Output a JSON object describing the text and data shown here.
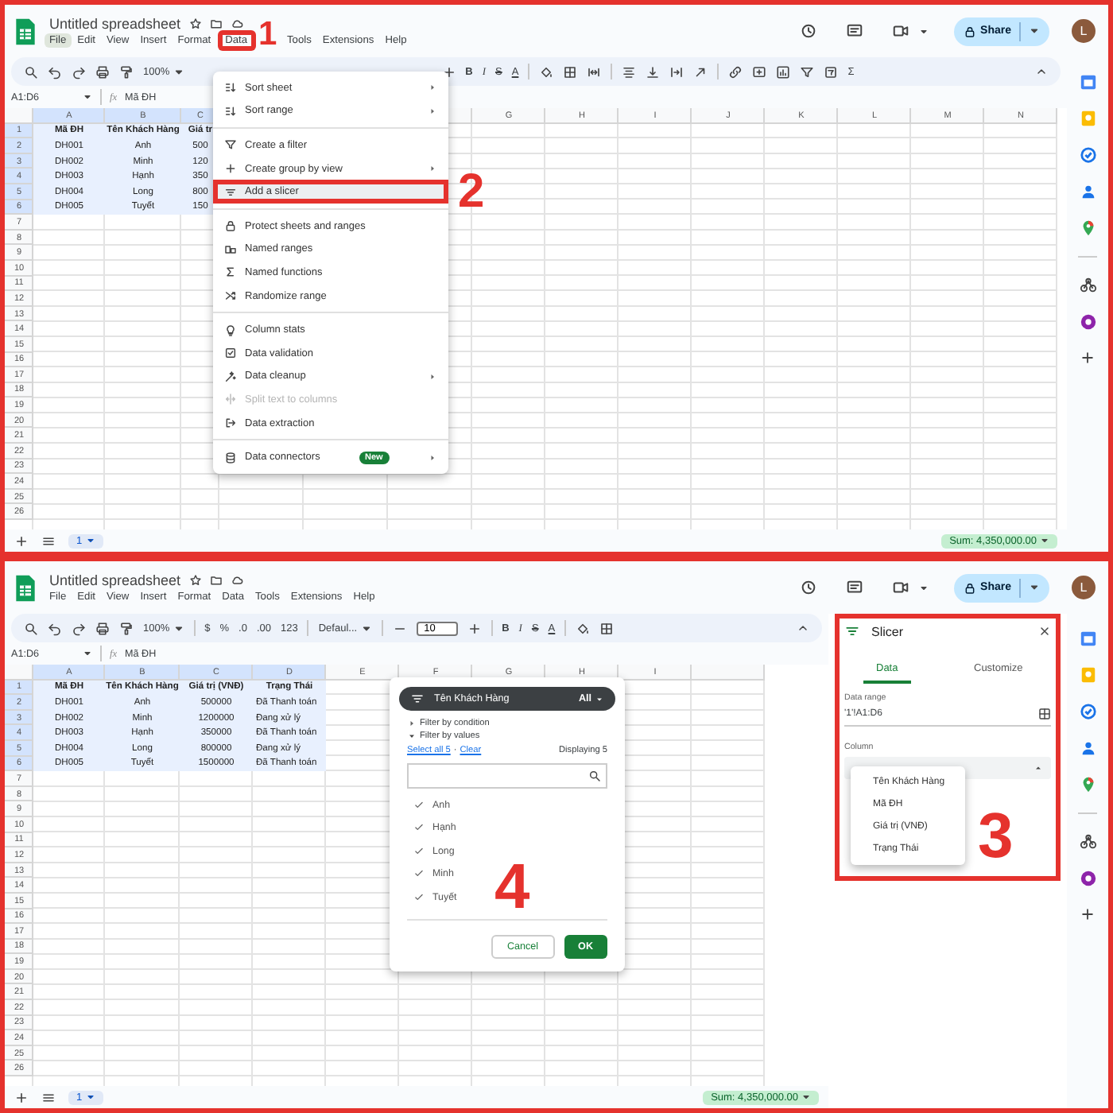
{
  "top_screen": {
    "title": "Untitled spreadsheet",
    "menu_bar": [
      {
        "label": "File",
        "selected": true
      },
      {
        "label": "Edit",
        "selected": false
      },
      {
        "label": "View",
        "selected": false
      },
      {
        "label": "Insert",
        "selected": false
      },
      {
        "label": "Format",
        "selected": false
      },
      {
        "label": "Data",
        "selected": false,
        "annotation": "1"
      },
      {
        "label": "Tools",
        "selected": false
      },
      {
        "label": "Extensions",
        "selected": false
      },
      {
        "label": "Help",
        "selected": false
      }
    ],
    "share": "Share",
    "avatar": "L",
    "toolbar": [
      {
        "kind": "search"
      },
      {
        "kind": "undo"
      },
      {
        "kind": "redo"
      },
      {
        "kind": "print"
      },
      {
        "kind": "paint_format"
      },
      {
        "kind": "zoom",
        "text": "100%"
      },
      {
        "kind": "covered"
      },
      {
        "kind": "font_size_plus"
      },
      {
        "kind": "bold",
        "text": "B"
      },
      {
        "kind": "italic",
        "text": "I"
      },
      {
        "kind": "strike",
        "text": "S"
      },
      {
        "kind": "text_color",
        "text": "A"
      },
      {
        "kind": "divider"
      },
      {
        "kind": "fill"
      },
      {
        "kind": "borders"
      },
      {
        "kind": "merge"
      },
      {
        "kind": "divider"
      },
      {
        "kind": "halign"
      },
      {
        "kind": "valign"
      },
      {
        "kind": "wrap"
      },
      {
        "kind": "rotate"
      },
      {
        "kind": "divider"
      },
      {
        "kind": "link"
      },
      {
        "kind": "comment"
      },
      {
        "kind": "chart"
      },
      {
        "kind": "filter"
      },
      {
        "kind": "filter_views"
      },
      {
        "kind": "functions",
        "text": "Σ"
      }
    ],
    "name_box": "A1:D6",
    "fx": "fx",
    "formula": "Mã ĐH",
    "columns": [
      {
        "label": "A"
      },
      {
        "label": "B"
      },
      {
        "label": "C"
      },
      {},
      {},
      {},
      {
        "label": "G"
      },
      {
        "label": "H"
      },
      {
        "label": "I"
      },
      {
        "label": "J"
      },
      {
        "label": "K"
      },
      {
        "label": "L"
      },
      {
        "label": "M"
      },
      {
        "label": "N"
      }
    ],
    "row_numbers": [
      "1",
      "2",
      "3",
      "4",
      "5",
      "6",
      "7",
      "8",
      "9",
      "10",
      "11",
      "12",
      "13",
      "14",
      "15",
      "16",
      "17",
      "18",
      "19",
      "20",
      "21",
      "22",
      "23",
      "24",
      "25",
      "26"
    ],
    "cells": [
      [
        "Mã ĐH",
        "Tên Khách Hàng",
        "Giá tr"
      ],
      [
        "DH001",
        "Anh",
        "500"
      ],
      [
        "DH002",
        "Minh",
        "120"
      ],
      [
        "DH003",
        "Hạnh",
        "350"
      ],
      [
        "DH004",
        "Long",
        "800"
      ],
      [
        "DH005",
        "Tuyết",
        "150"
      ]
    ],
    "sheet_tab": "1",
    "sum": "Sum: 4,350,000.00",
    "data_menu": {
      "groups": [
        {
          "items": [
            {
              "kind": "sort",
              "label": "Sort sheet",
              "submenu": true,
              "disabled": false,
              "selected": false
            },
            {
              "kind": "sort",
              "label": "Sort range",
              "submenu": true,
              "disabled": false,
              "selected": false
            }
          ]
        },
        {
          "items": [
            {
              "kind": "filter",
              "label": "Create a filter",
              "submenu": false,
              "disabled": false,
              "selected": false
            },
            {
              "kind": "group",
              "label": "Create group by view",
              "submenu": true,
              "disabled": false,
              "selected": false
            },
            {
              "kind": "slicer",
              "label": "Add a slicer",
              "submenu": false,
              "disabled": false,
              "selected": true,
              "annotation": "2"
            }
          ]
        },
        {
          "items": [
            {
              "kind": "protect",
              "label": "Protect sheets and ranges",
              "submenu": false,
              "disabled": false,
              "selected": false
            },
            {
              "kind": "ranges",
              "label": "Named ranges",
              "submenu": false,
              "disabled": false,
              "selected": false
            },
            {
              "kind": "functions",
              "label": "Named functions",
              "submenu": false,
              "disabled": false,
              "selected": false
            },
            {
              "kind": "randomize",
              "label": "Randomize range",
              "submenu": false,
              "disabled": false,
              "selected": false
            }
          ]
        },
        {
          "items": [
            {
              "kind": "stats",
              "label": "Column stats",
              "submenu": false,
              "disabled": false,
              "selected": false
            },
            {
              "kind": "validation",
              "label": "Data validation",
              "submenu": false,
              "disabled": false,
              "selected": false
            },
            {
              "kind": "cleanup",
              "label": "Data cleanup",
              "submenu": true,
              "disabled": false,
              "selected": false
            },
            {
              "kind": "split",
              "label": "Split text to columns",
              "submenu": false,
              "disabled": true,
              "selected": false
            },
            {
              "kind": "extraction",
              "label": "Data extraction",
              "submenu": false,
              "disabled": false,
              "selected": false
            }
          ]
        },
        {
          "items": [
            {
              "kind": "connectors",
              "label": "Data connectors",
              "badge": "New",
              "submenu": true,
              "disabled": false,
              "selected": false
            }
          ]
        }
      ]
    }
  },
  "bottom_screen": {
    "title": "Untitled spreadsheet",
    "menu_bar": [
      {
        "label": "File",
        "selected": false
      },
      {
        "label": "Edit",
        "selected": false
      },
      {
        "label": "View",
        "selected": false
      },
      {
        "label": "Insert",
        "selected": false
      },
      {
        "label": "Format",
        "selected": false
      },
      {
        "label": "Data",
        "selected": false
      },
      {
        "label": "Tools",
        "selected": false
      },
      {
        "label": "Extensions",
        "selected": false
      },
      {
        "label": "Help",
        "selected": false
      }
    ],
    "share": "Share",
    "avatar": "L",
    "toolbar": [
      {
        "kind": "search"
      },
      {
        "kind": "undo"
      },
      {
        "kind": "redo"
      },
      {
        "kind": "print"
      },
      {
        "kind": "paint_format"
      },
      {
        "kind": "zoom",
        "text": "100%"
      },
      {
        "kind": "divider"
      },
      {
        "kind": "currency",
        "text": "$"
      },
      {
        "kind": "percent",
        "text": "%"
      },
      {
        "kind": "decimal_decrease",
        "text": ".0"
      },
      {
        "kind": "decimal_increase",
        "text": ".00"
      },
      {
        "kind": "number_format",
        "text": "123"
      },
      {
        "kind": "divider"
      },
      {
        "kind": "font",
        "text": "Defaul..."
      },
      {
        "kind": "divider"
      },
      {
        "kind": "font_size_minus"
      },
      {
        "kind": "font_size",
        "text": "10"
      },
      {
        "kind": "font_size_plus"
      },
      {
        "kind": "divider"
      },
      {
        "kind": "bold",
        "text": "B"
      },
      {
        "kind": "italic",
        "text": "I"
      },
      {
        "kind": "strike",
        "text": "S"
      },
      {
        "kind": "text_color",
        "text": "A"
      },
      {
        "kind": "divider"
      },
      {
        "kind": "fill"
      },
      {
        "kind": "borders"
      }
    ],
    "name_box": "A1:D6",
    "fx": "fx",
    "formula": "Mã ĐH",
    "columns": [
      {
        "label": "A"
      },
      {
        "label": "B"
      },
      {
        "label": "C"
      },
      {
        "label": "D"
      },
      {
        "label": "E"
      },
      {
        "label": "F"
      },
      {
        "label": "G"
      },
      {
        "label": "H"
      },
      {
        "label": "I"
      },
      {}
    ],
    "row_numbers": [
      "1",
      "2",
      "3",
      "4",
      "5",
      "6",
      "7",
      "8",
      "9",
      "10",
      "11",
      "12",
      "13",
      "14",
      "15",
      "16",
      "17",
      "18",
      "19",
      "20",
      "21",
      "22",
      "23",
      "24",
      "25",
      "26"
    ],
    "cells": [
      [
        "Mã ĐH",
        "Tên Khách Hàng",
        "Giá trị (VNĐ)",
        "Trạng Thái"
      ],
      [
        "DH001",
        "Anh",
        "500000",
        "Đã Thanh toán"
      ],
      [
        "DH002",
        "Minh",
        "1200000",
        "Đang xử lý"
      ],
      [
        "DH003",
        "Hạnh",
        "350000",
        "Đã Thanh toán"
      ],
      [
        "DH004",
        "Long",
        "800000",
        "Đang xử lý"
      ],
      [
        "DH005",
        "Tuyết",
        "1500000",
        "Đã Thanh toán"
      ]
    ],
    "sheet_tab": "1",
    "sum": "Sum: 4,350,000.00",
    "filter_dialog": {
      "annotation": "4",
      "column": "Tên Khách Hàng",
      "selection": "All",
      "sections": [
        {
          "label": "Filter by condition",
          "expanded": false
        },
        {
          "label": "Filter by values",
          "expanded": true
        }
      ],
      "select_all": "Select all 5",
      "separator": "·",
      "clear": "Clear",
      "displaying": "Displaying 5",
      "values": [
        {
          "label": "Anh",
          "checked": true
        },
        {
          "label": "Hạnh",
          "checked": true
        },
        {
          "label": "Long",
          "checked": true
        },
        {
          "label": "Minh",
          "checked": true
        },
        {
          "label": "Tuyết",
          "checked": true
        }
      ],
      "cancel": "Cancel",
      "ok": "OK"
    },
    "slicer_panel": {
      "annotation": "3",
      "title": "Slicer",
      "tabs": [
        {
          "label": "Data",
          "selected": true
        },
        {
          "label": "Customize",
          "selected": false
        }
      ],
      "data_range_label": "Data range",
      "data_range": "'1'!A1:D6",
      "column_label": "Column",
      "column_options": [
        "Tên Khách Hàng",
        "Mã ĐH",
        "Giá trị (VNĐ)",
        "Trạng Thái"
      ]
    }
  }
}
